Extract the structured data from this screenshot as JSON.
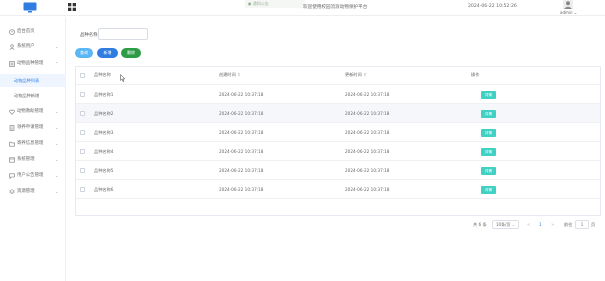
{
  "topbar": {
    "notice": "● 通知公告",
    "welcome": "欢迎使用校园流浪动物保护平台",
    "datetime": "2024-06-22 10:52:26",
    "user": "admin"
  },
  "sidebar": {
    "items": [
      {
        "label": "后台首页",
        "icon": "clock-icon"
      },
      {
        "label": "系统用户",
        "icon": "user-icon",
        "chevron": "⌄"
      },
      {
        "label": "动物品种管理",
        "icon": "grid-icon",
        "chevron": "⌃"
      },
      {
        "label": "动物救助管理",
        "icon": "heart-icon",
        "chevron": "⌄"
      },
      {
        "label": "领养申请管理",
        "icon": "document-icon",
        "chevron": "⌄"
      },
      {
        "label": "寄养信息管理",
        "icon": "folder-icon",
        "chevron": "⌄"
      },
      {
        "label": "系统管理",
        "icon": "settings-icon",
        "chevron": "⌄"
      },
      {
        "label": "用户公告管理",
        "icon": "chat-icon",
        "chevron": "⌄"
      },
      {
        "label": "资源管理",
        "icon": "layers-icon",
        "chevron": "⌄"
      }
    ],
    "subitems": [
      {
        "label": "动物品种列表",
        "active": true
      },
      {
        "label": "动物品种新增",
        "active": false
      }
    ]
  },
  "filter": {
    "label": "品种名称",
    "value": "",
    "placeholder": ""
  },
  "buttons": {
    "search": "查询",
    "add": "新增",
    "delete": "删除"
  },
  "table": {
    "headers": [
      "品种名称",
      "创建时间",
      "更新时间",
      "操作"
    ],
    "rows": [
      {
        "name": "品种名称1",
        "created": "2024-06-22 10:37:18",
        "updated": "2024-06-22 10:37:18",
        "action": "详情"
      },
      {
        "name": "品种名称2",
        "created": "2024-06-22 10:37:18",
        "updated": "2024-06-22 10:37:18",
        "action": "详情"
      },
      {
        "name": "品种名称3",
        "created": "2024-06-22 10:37:18",
        "updated": "2024-06-22 10:37:18",
        "action": "详情"
      },
      {
        "name": "品种名称4",
        "created": "2024-06-22 10:37:18",
        "updated": "2024-06-22 10:37:18",
        "action": "详情"
      },
      {
        "name": "品种名称5",
        "created": "2024-06-22 10:37:18",
        "updated": "2024-06-22 10:37:18",
        "action": "详情"
      },
      {
        "name": "品种名称6",
        "created": "2024-06-22 10:37:18",
        "updated": "2024-06-22 10:37:18",
        "action": "详情"
      }
    ]
  },
  "pagination": {
    "total": "共 6 条",
    "page_size": "10条/页",
    "prev": "<",
    "page": "1",
    "next": ">",
    "goto": "前往",
    "goto_value": "1",
    "goto_suffix": "页"
  },
  "colors": {
    "primary": "#2f7de1",
    "search": "#5ab6f5",
    "delete": "#2e9b47",
    "detail": "#41d1c4"
  }
}
